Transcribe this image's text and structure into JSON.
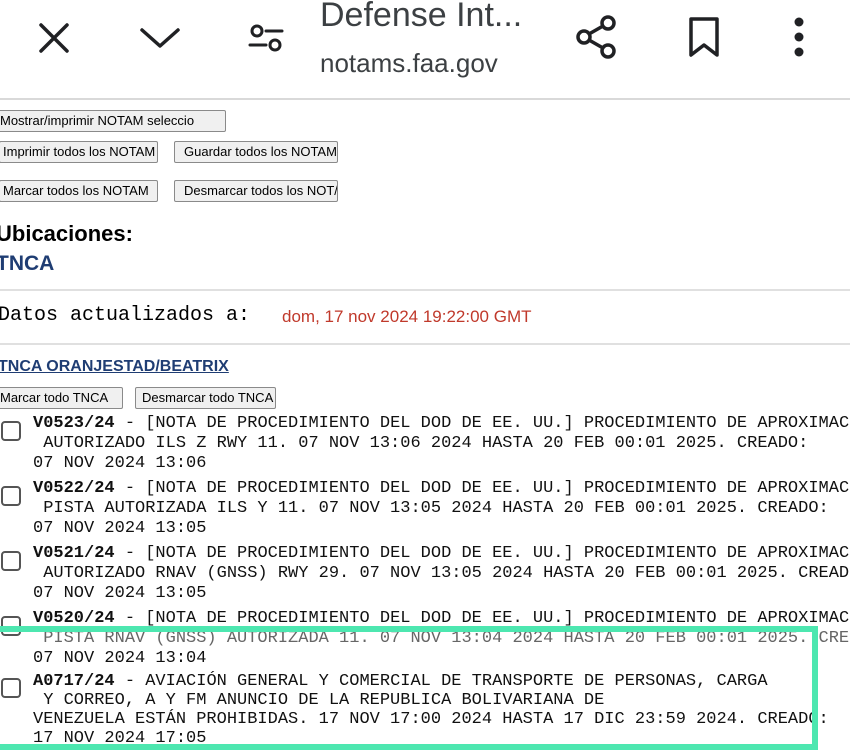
{
  "browser": {
    "title": "Defense Int...",
    "url": "notams.faa.gov",
    "icons": [
      "close-icon",
      "chevron-down-icon",
      "tune-icon",
      "share-icon",
      "bookmark-icon",
      "more-vert-icon"
    ]
  },
  "buttons": {
    "show_print_selected": "Mostrar/imprimir NOTAM seleccio",
    "print_all": "Imprimir todos los NOTAM",
    "save_all": "Guardar todos los NOTAM",
    "mark_all": "Marcar todos los NOTAM",
    "unmark_all": "Desmarcar todos los NOT/",
    "mark_airport": "Marcar todo TNCA",
    "unmark_airport": "Desmarcar todo TNCA"
  },
  "locations": {
    "heading": "Ubicaciones:",
    "code": "TNCA"
  },
  "updated": {
    "label": "Datos actualizados a:",
    "value": "dom, 17 nov 2024 19:22:00 GMT"
  },
  "airport": {
    "name": "TNCA ORANJESTAD/BEATRIX"
  },
  "notams": [
    {
      "id": "V0523/24",
      "line1": " - [NOTA DE PROCEDIMIENTO DEL DOD DE EE. UU.] PROCEDIMIENTO DE APROXIMAC",
      "line2": " AUTORIZADO ILS Z RWY 11. 07 NOV 13:06 2024 HASTA 20 FEB 00:01 2025. CREADO:",
      "line3": "07 NOV 2024 13:06"
    },
    {
      "id": "V0522/24",
      "line1": " - [NOTA DE PROCEDIMIENTO DEL DOD DE EE. UU.] PROCEDIMIENTO DE APROXIMAC",
      "line2": " PISTA AUTORIZADA ILS Y 11. 07 NOV 13:05 2024 HASTA 20 FEB 00:01 2025. CREADO:",
      "line3": "07 NOV 2024 13:05"
    },
    {
      "id": "V0521/24",
      "line1": " - [NOTA DE PROCEDIMIENTO DEL DOD DE EE. UU.] PROCEDIMIENTO DE APROXIMAC",
      "line2": " AUTORIZADO RNAV (GNSS) RWY 29. 07 NOV 13:05 2024 HASTA 20 FEB 00:01 2025. CREAD",
      "line3": "07 NOV 2024 13:05"
    },
    {
      "id": "V0520/24",
      "line1": " - [NOTA DE PROCEDIMIENTO DEL DOD DE EE. UU.] PROCEDIMIENTO DE APROXIMAC",
      "line2": " PISTA RNAV (GNSS) AUTORIZADA 11. 07 NOV 13:04 2024 HASTA 20 FEB 00:01 2025. CRE",
      "line3": "07 NOV 2024 13:04"
    },
    {
      "id": "A0717/24",
      "line1": " - AVIACIÓN GENERAL Y COMERCIAL DE TRANSPORTE DE PERSONAS, CARGA",
      "line2": " Y CORREO, A Y FM ANUNCIO DE LA REPUBLICA BOLIVARIANA DE",
      "line3": "VENEZUELA ESTÁN PROHIBIDAS. 17 NOV 17:00 2024 HASTA 17 DIC 23:59 2024. CREADO:",
      "line4": "17 NOV 2024 17:05"
    }
  ],
  "colors": {
    "highlight": "#4de7b0",
    "link": "#1f3d73",
    "timestamp": "#c0392b"
  }
}
